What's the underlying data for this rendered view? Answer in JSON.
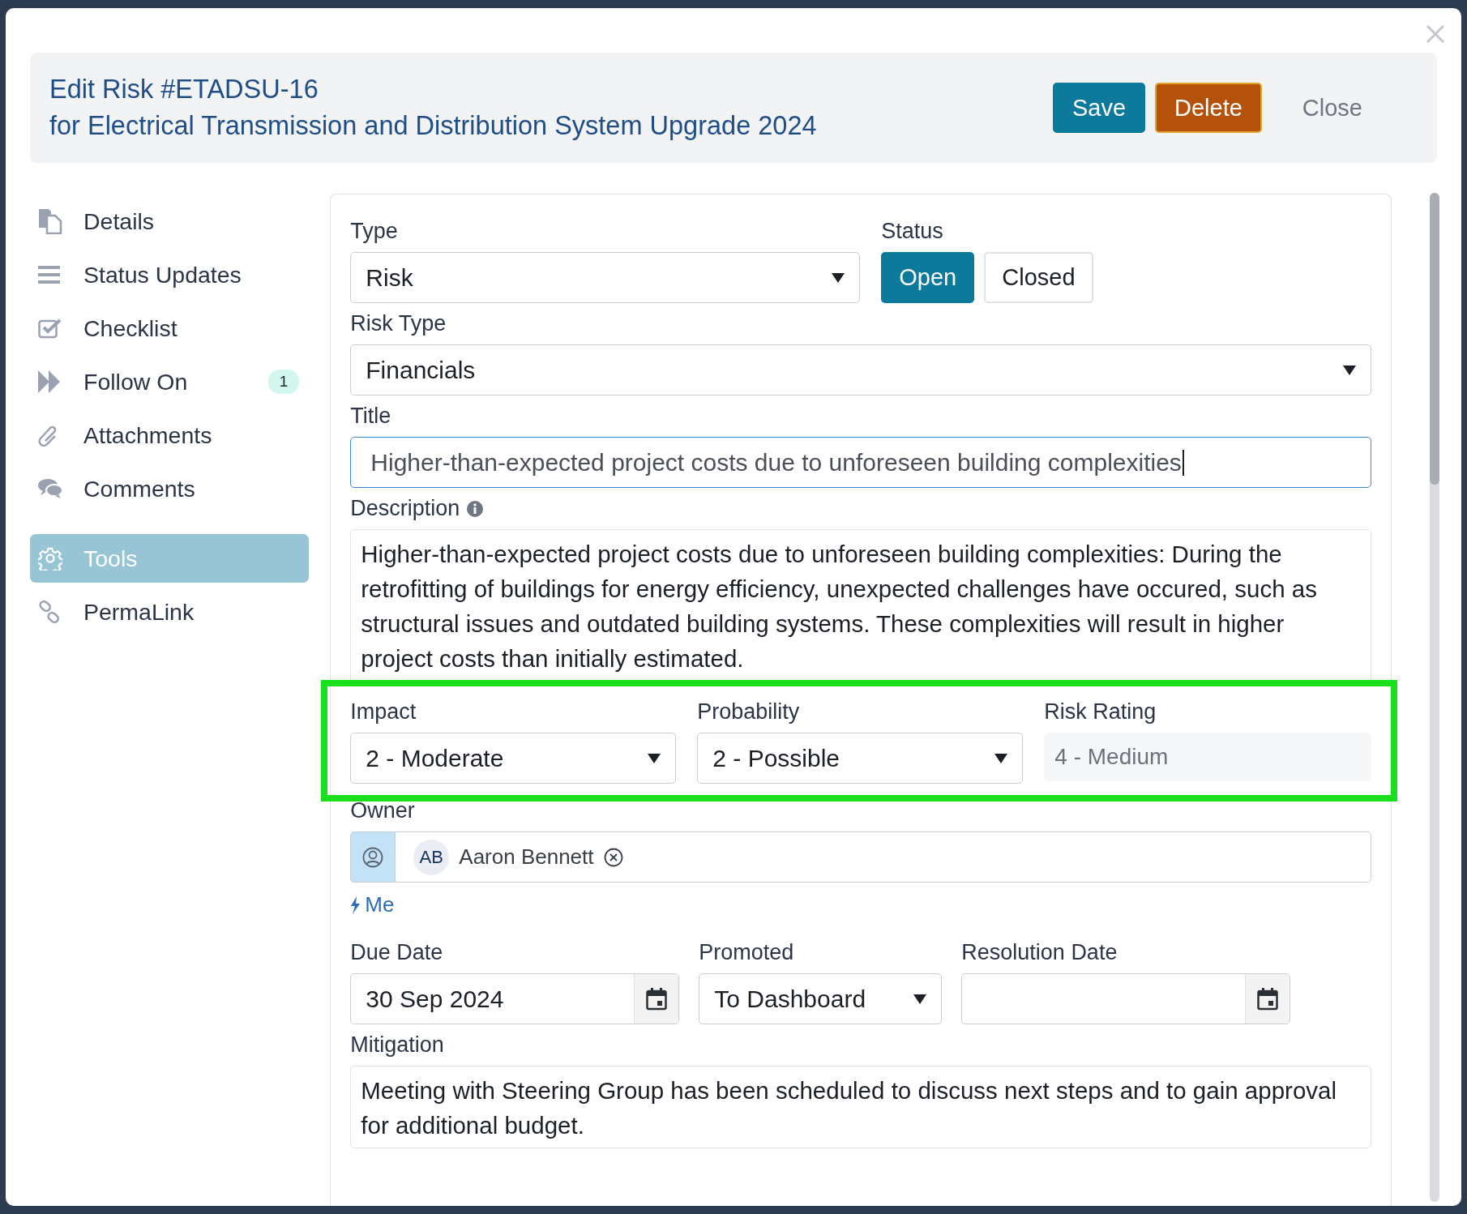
{
  "dialog": {
    "title": "Edit Risk #ETADSU-16",
    "subtitle": "for Electrical Transmission and Distribution System Upgrade 2024",
    "buttons": [
      {
        "label": "Save",
        "kind": "primary"
      },
      {
        "label": "Delete",
        "kind": "danger"
      },
      {
        "label": "Close",
        "kind": "plain"
      }
    ]
  },
  "sidebar": {
    "items": [
      {
        "label": "Details",
        "selected": false
      },
      {
        "label": "Status Updates",
        "selected": false
      },
      {
        "label": "Checklist",
        "selected": false
      },
      {
        "label": "Follow On",
        "badge": "1",
        "selected": false
      },
      {
        "label": "Attachments",
        "selected": false
      },
      {
        "label": "Comments",
        "selected": false
      },
      {
        "label": "Tools",
        "selected": true
      },
      {
        "label": "PermaLink",
        "selected": false
      }
    ]
  },
  "form": {
    "type": {
      "label": "Type",
      "value": "Risk"
    },
    "status": {
      "label": "Status",
      "options": [
        {
          "label": "Open",
          "selected": true
        },
        {
          "label": "Closed",
          "selected": false
        }
      ]
    },
    "risk_type": {
      "label": "Risk Type",
      "value": "Financials"
    },
    "title": {
      "label": "Title",
      "value": "Higher-than-expected project costs due to unforeseen building complexities",
      "focused": true
    },
    "description": {
      "label": "Description",
      "value": "Higher-than-expected project costs due to unforeseen building complexities: During the retrofitting of buildings for energy efficiency, unexpected challenges have occured, such as structural issues and outdated building systems. These complexities will result in higher project costs than initially estimated."
    },
    "assessment": {
      "highlighted": true,
      "impact": {
        "label": "Impact",
        "value": "2 - Moderate"
      },
      "probability": {
        "label": "Probability",
        "value": "2 - Possible"
      },
      "risk_rating": {
        "label": "Risk Rating",
        "value": "4 - Medium",
        "disabled": true
      }
    },
    "owner": {
      "label": "Owner",
      "person": {
        "initials": "AB",
        "name": "Aaron Bennett"
      },
      "shortcut": "Me"
    },
    "due_date": {
      "label": "Due Date",
      "value": "30 Sep 2024"
    },
    "promoted": {
      "label": "Promoted",
      "value": "To Dashboard"
    },
    "resolution_date": {
      "label": "Resolution Date"
    },
    "mitigation": {
      "label": "Mitigation",
      "value": "Meeting with Steering Group has been scheduled to discuss next steps and to gain approval for additional budget."
    }
  }
}
